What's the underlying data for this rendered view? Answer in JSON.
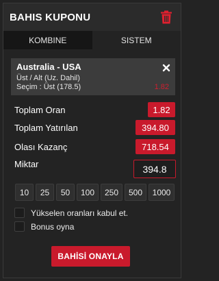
{
  "header": {
    "title": "BAHIS KUPONU",
    "trash_icon": "trash-icon",
    "accent_color": "#d01f2f"
  },
  "tabs": [
    {
      "label": "KOMBINE",
      "active": true
    },
    {
      "label": "SISTEM",
      "active": false
    }
  ],
  "bet": {
    "match": "Australia - USA",
    "market": "Üst / Alt (Uz. Dahil)",
    "selection": "Seçim : Üst (178.5)",
    "odds": "1.82",
    "close_icon": "close-icon"
  },
  "summary": {
    "total_odds_label": "Toplam Oran",
    "total_odds_value": "1.82",
    "total_stake_label": "Toplam Yatırılan",
    "total_stake_value": "394.80",
    "potential_win_label": "Olası Kazanç",
    "potential_win_value": "718.54",
    "amount_label": "Miktar",
    "amount_value": "394.8"
  },
  "quick_amounts": [
    "10",
    "25",
    "50",
    "100",
    "250",
    "500",
    "1000"
  ],
  "options": {
    "accept_rising_odds": "Yükselen oranları kabul et.",
    "play_bonus": "Bonus oyna"
  },
  "confirm_button": "BAHİSİ ONAYLA"
}
